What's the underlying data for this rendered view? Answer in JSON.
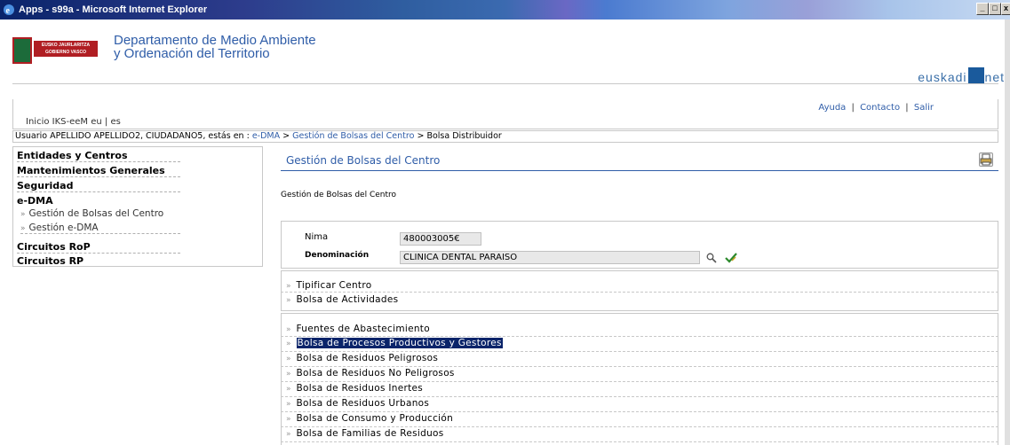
{
  "window": {
    "title": "Apps - s99a - Microsoft Internet Explorer",
    "controls": [
      "_",
      "□",
      "x"
    ]
  },
  "header": {
    "dept_line1": "Departamento de Medio Ambiente",
    "dept_line2": "y Ordenación del Territorio",
    "logo_text1": "EUSKO JAURLARITZA",
    "logo_text2": "GOBIERNO VASCO",
    "brand_left": "euskadi",
    "brand_right": "net"
  },
  "topbar": {
    "left_links": "Inicio IKS-eeM",
    "lang": "eu | es",
    "help": "Ayuda",
    "contact": "Contacto",
    "exit": "Salir",
    "sep": "|"
  },
  "breadcrumb": {
    "prefix": "Usuario APELLIDO APELLIDO2, CIUDADANO5, estás en :",
    "crumb1": "e-DMA",
    "sep": ">",
    "crumb2": "Gestión de Bolsas del Centro",
    "current": "Bolsa Distribuidor"
  },
  "sidebar": {
    "items": [
      {
        "label": "Entidades y Centros"
      },
      {
        "label": "Mantenimientos Generales"
      },
      {
        "label": "Seguridad"
      },
      {
        "label": "e-DMA"
      }
    ],
    "subitems": [
      {
        "label": "Gestión de Bolsas del Centro"
      },
      {
        "label": "Gestión e-DMA"
      }
    ],
    "items_after": [
      {
        "label": "Circuitos RoP"
      },
      {
        "label": "Circuitos RP"
      }
    ],
    "arrow": "»"
  },
  "main": {
    "title": "Gestión de Bolsas del Centro",
    "subtitle": "Gestión de Bolsas del Centro",
    "form": {
      "nima_label": "Nima",
      "nima_value": "480003005€",
      "denom_label": "Denominación",
      "denom_value": "CLINICA DENTAL PARAISO"
    },
    "group1": [
      {
        "label": "Tipificar Centro"
      },
      {
        "label": "Bolsa de Actividades"
      }
    ],
    "group2": [
      {
        "label": "Fuentes de Abastecimiento"
      },
      {
        "label": "Bolsa de Procesos Productivos y Gestores",
        "selected": true
      },
      {
        "label": "Bolsa de Residuos Peligrosos"
      },
      {
        "label": "Bolsa de Residuos No Peligrosos"
      },
      {
        "label": "Bolsa de Residuos Inertes"
      },
      {
        "label": "Bolsa de Residuos Urbanos"
      },
      {
        "label": "Bolsa de Consumo y Producción"
      },
      {
        "label": "Bolsa de Familias de Residuos"
      }
    ],
    "arrow": "»"
  },
  "colors": {
    "link": "#2f5da8",
    "selection": "#0a246a",
    "border": "#c8c8c8"
  },
  "icons": {
    "ie": "ie-icon",
    "print": "print-icon",
    "search": "search-icon",
    "check": "check-icon"
  }
}
